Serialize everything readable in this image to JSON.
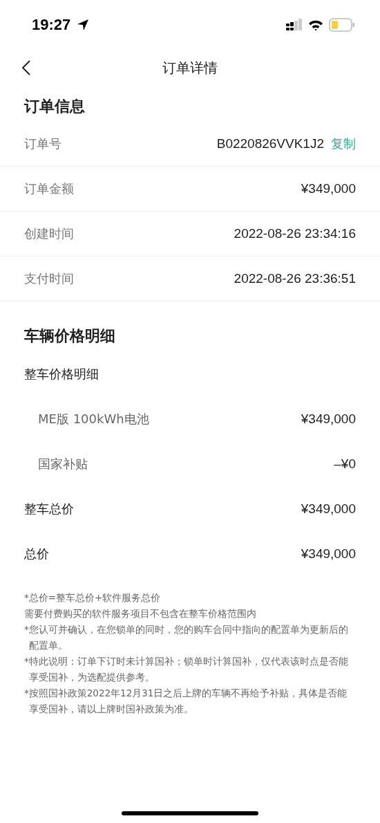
{
  "status_bar": {
    "time": "19:27"
  },
  "nav": {
    "title": "订单详情"
  },
  "order_info": {
    "title": "订单信息",
    "rows": [
      {
        "label": "订单号",
        "value": "B0220826VVK1J2",
        "action": "复制"
      },
      {
        "label": "订单金额",
        "value": "¥349,000"
      },
      {
        "label": "创建时间",
        "value": "2022-08-26 23:34:16"
      },
      {
        "label": "支付时间",
        "value": "2022-08-26 23:36:51"
      }
    ]
  },
  "price_detail": {
    "title": "车辆价格明细",
    "rows": [
      {
        "kind": "group",
        "label": "整车价格明细"
      },
      {
        "kind": "item",
        "label": "ME版 100kWh电池",
        "value": "¥349,000"
      },
      {
        "kind": "item",
        "label": "国家补贴",
        "value": "–¥0"
      },
      {
        "kind": "total",
        "label": "整车总价",
        "value": "¥349,000"
      },
      {
        "kind": "total",
        "label": "总价",
        "value": "¥349,000"
      }
    ]
  },
  "notes": [
    "*总价=整车总价+软件服务总价",
    "需要付费购买的软件服务项目不包含在整车价格范围内",
    "*您认可并确认，在您锁单的同时，您的购车合同中指向的配置单为更新后的配置单。",
    "*特此说明：订单下订时未计算国补；锁单时计算国补，仅代表该时点是否能享受国补，为选配提供参考。",
    "*按照国补政策2022年12月31日之后上牌的车辆不再给予补贴，具体是否能享受国补，请以上牌时国补政策为准。"
  ]
}
